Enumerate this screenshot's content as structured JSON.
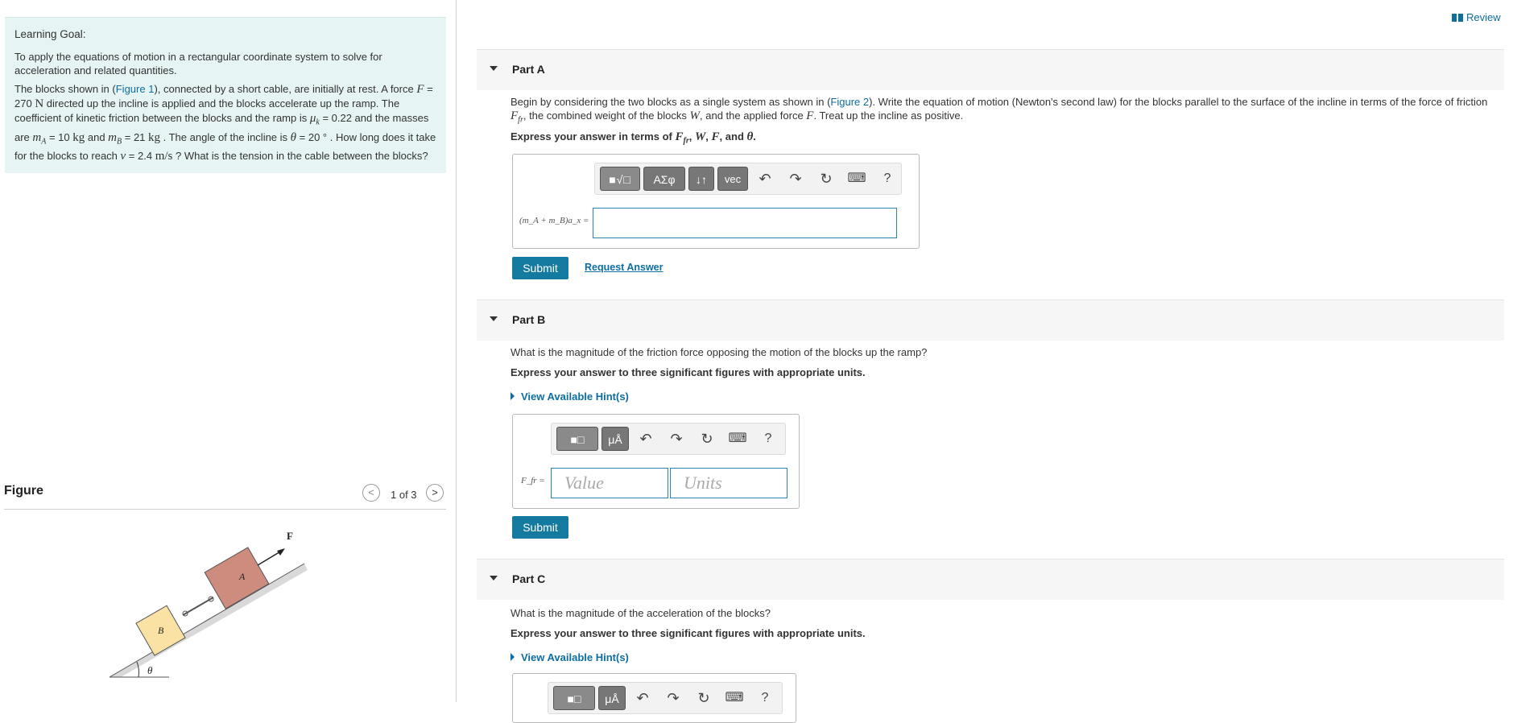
{
  "learning_goal": {
    "title": "Learning Goal:",
    "text": "To apply the equations of motion in a rectangular coordinate system to solve for acceleration and related quantities.",
    "p1": "The blocks shown in (",
    "figure1_link": "Figure 1",
    "p2": "), connected by a short cable, are initially at rest. A force ",
    "F": "F",
    "p3": " = 270 ",
    "N": "N",
    "p4": " directed up the incline is applied and the blocks accelerate up the ramp. The coefficient of kinetic friction between the blocks and the ramp is ",
    "muk": "μ",
    "muk_sub": "k",
    "p5": " = 0.22 and the masses are ",
    "mA": "m",
    "mA_sub": "A",
    "p6": " = 10 ",
    "kg1": "kg",
    "p7": " and ",
    "mB": "m",
    "mB_sub": "B",
    "p8": " = 21 ",
    "kg2": "kg",
    "p9": " . The angle of the incline is ",
    "theta": "θ",
    "p10": " = 20 ° . How long does it take for the blocks to reach ",
    "v": "v",
    "p11": " = 2.4 ",
    "ms": "m/s",
    "p12": " ? What is the tension in the cable between the blocks?"
  },
  "figure": {
    "title": "Figure",
    "prev": "<",
    "next": ">",
    "count": "1 of 3",
    "label_F": "F",
    "label_A": "A",
    "label_B": "B",
    "label_theta": "θ"
  },
  "review": {
    "label": "Review"
  },
  "part_a": {
    "title": "Part A",
    "q1": "Begin by considering the two blocks as a single system as shown in (",
    "fig2": "Figure 2",
    "q2": "). Write the equation of motion (Newton's second law) for the blocks parallel to the surface of the incline in terms of the force of friction ",
    "Ffr": "F",
    "Ffr_sub": "fr",
    "q3": ", the combined weight of the blocks ",
    "W": "W",
    "q4": ", and the applied force ",
    "F": "F",
    "q5": ". Treat up the incline as positive.",
    "express": "Express your answer in terms of ",
    "express_Ffr": "F",
    "express_Ffr_sub": "fr",
    "express_rest1": ", ",
    "express_W": "W",
    "express_rest2": ", ",
    "express_F": "F",
    "express_rest3": ", and ",
    "express_theta": "θ",
    "express_end": ".",
    "toolbar": {
      "templates": "■√□",
      "greek": "ΑΣφ",
      "arrows": "↓↑",
      "vec": "vec",
      "undo": "↶",
      "redo": "↷",
      "reset": "↻",
      "keyboard": "⌨",
      "help": "?"
    },
    "eq_label": "(m_A + m_B)a_x =",
    "submit": "Submit",
    "request": "Request Answer"
  },
  "part_b": {
    "title": "Part B",
    "question": "What is the magnitude of the friction force opposing the motion of the blocks up the ramp?",
    "express": "Express your answer to three significant figures with appropriate units.",
    "hint": "View Available Hint(s)",
    "toolbar": {
      "templates": "■□",
      "units": "μÅ",
      "undo": "↶",
      "redo": "↷",
      "reset": "↻",
      "keyboard": "⌨",
      "help": "?"
    },
    "eq_label": "F_fr =",
    "value_placeholder": "Value",
    "units_placeholder": "Units",
    "submit": "Submit"
  },
  "part_c": {
    "title": "Part C",
    "question": "What is the magnitude of the acceleration of the blocks?",
    "express": "Express your answer to three significant figures with appropriate units.",
    "hint": "View Available Hint(s)",
    "toolbar": {
      "templates": "■□",
      "units": "μÅ",
      "undo": "↶",
      "redo": "↷",
      "reset": "↻",
      "keyboard": "⌨",
      "help": "?"
    }
  },
  "colors": {
    "link": "#0d6ea0",
    "goal_bg": "#e6f4f4",
    "submit_bg": "#157aa0",
    "block_a": "#cd8c7e",
    "block_b": "#f9e2a4"
  }
}
